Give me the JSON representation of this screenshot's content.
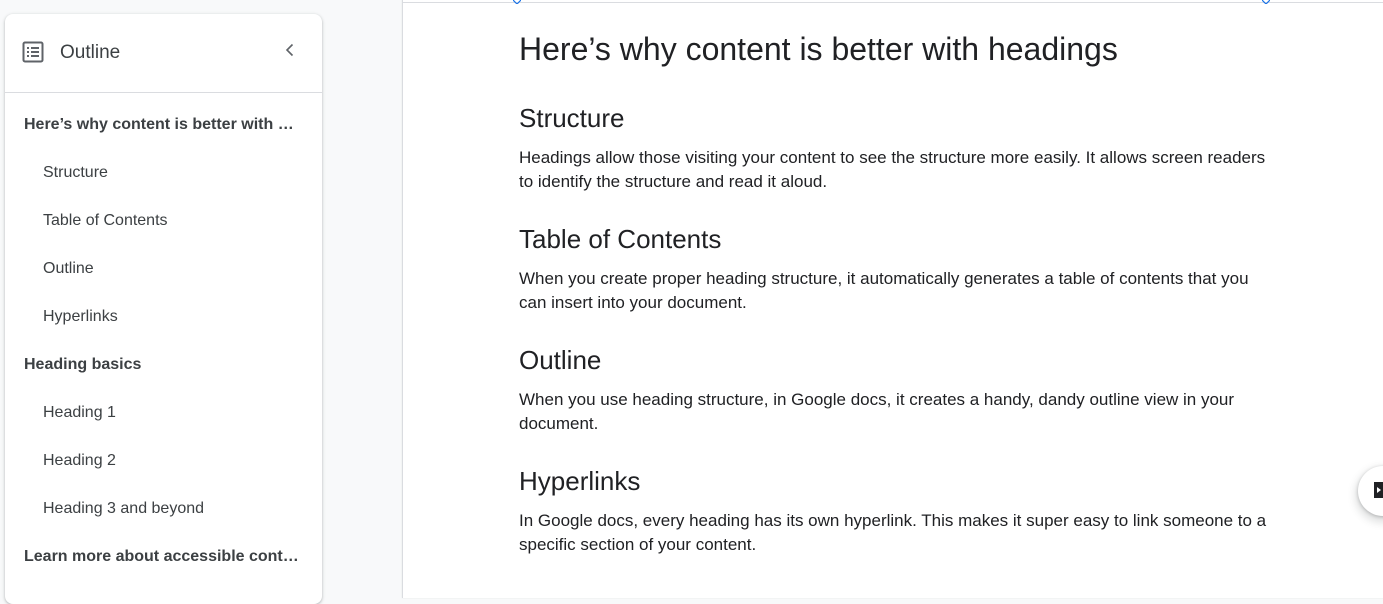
{
  "outline": {
    "title": "Outline",
    "icon": "outline-list-icon",
    "collapse_icon": "chevron-left-icon",
    "items": [
      {
        "label": "Here’s why content is better with headings",
        "level": 1
      },
      {
        "label": "Structure",
        "level": 2
      },
      {
        "label": "Table of Contents",
        "level": 2
      },
      {
        "label": "Outline",
        "level": 2
      },
      {
        "label": "Hyperlinks",
        "level": 2
      },
      {
        "label": "Heading basics",
        "level": 1
      },
      {
        "label": "Heading 1",
        "level": 2
      },
      {
        "label": "Heading 2",
        "level": 2
      },
      {
        "label": "Heading 3 and beyond",
        "level": 2
      },
      {
        "label": "Learn more about accessible content",
        "level": 1
      }
    ]
  },
  "document": {
    "title": "Here’s why content is better with headings",
    "sections": [
      {
        "heading": "Structure",
        "body": "Headings allow those visiting your content to see the structure more easily. It allows screen readers to identify the structure and read it aloud."
      },
      {
        "heading": "Table of Contents",
        "body": "When you create proper heading structure, it automatically generates a table of contents that you can insert into your document."
      },
      {
        "heading": "Outline",
        "body": "When you use heading structure, in Google docs, it creates a handy, dandy outline view in your document."
      },
      {
        "heading": "Hyperlinks",
        "body": "In Google docs, every heading has its own hyperlink. This makes it super easy to link someone to a specific section of your content."
      }
    ]
  },
  "colors": {
    "accent": "#1a73e8",
    "text": "#202124",
    "panel_text": "#3c4043"
  },
  "fab": {
    "icon": "explore-icon"
  }
}
